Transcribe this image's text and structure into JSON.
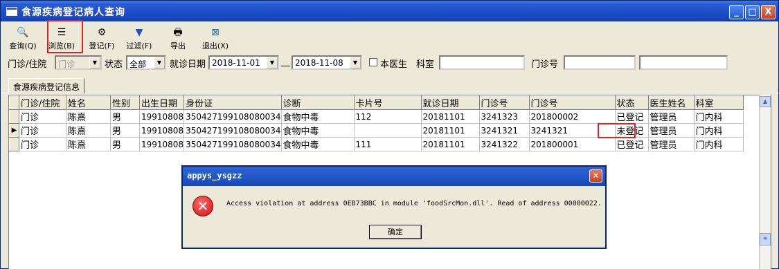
{
  "window": {
    "title": "食源疾病登记病人查询"
  },
  "titlebar_buttons": {
    "minimize": "_",
    "maximize": "□",
    "close": "X"
  },
  "toolbar": [
    {
      "label": "查询(Q)",
      "icon": "magnifier-icon",
      "glyph": "🔍"
    },
    {
      "label": "浏览(B)",
      "icon": "browse-list-icon",
      "glyph": "☰"
    },
    {
      "label": "登记(F)",
      "icon": "gear-icon",
      "glyph": "⚙"
    },
    {
      "label": "过滤(F)",
      "icon": "funnel-icon",
      "glyph": "▼"
    },
    {
      "label": "导出",
      "icon": "printer-icon",
      "glyph": "🖶"
    },
    {
      "label": "退出(X)",
      "icon": "exit-icon",
      "glyph": "⊠"
    }
  ],
  "filters": {
    "type_label": "门诊/住院",
    "type_value": "门诊",
    "status_label": "状态",
    "status_value": "全部",
    "date_label": "就诊日期",
    "date_from": "2018-11-01",
    "date_sep": "__",
    "date_to": "2018-11-08",
    "my_doctor_label": "本医生",
    "dept_label": "科室",
    "dept_value": "",
    "clinic_no_label": "门诊号",
    "clinic_no_value": "",
    "extra_value": ""
  },
  "tab": {
    "label": "食源疾病登记信息"
  },
  "table": {
    "columns": [
      "门诊/住院",
      "姓名",
      "性别",
      "出生日期",
      "身份证",
      "诊断",
      "卡片号",
      "就诊日期",
      "门诊号",
      "门诊号",
      "状态",
      "医生姓名",
      "科室"
    ],
    "rows": [
      [
        "门诊",
        "陈熹",
        "男",
        "19910808",
        "350427199108080034",
        "食物中毒",
        "112",
        "20181101",
        "3241323",
        "201800002",
        "已登记",
        "管理员",
        "门内科"
      ],
      [
        "门诊",
        "陈熹",
        "男",
        "19910808",
        "350427199108080034",
        "食物中毒",
        "",
        "20181101",
        "3241321",
        "3241321",
        "未登记",
        "管理员",
        "门内科"
      ],
      [
        "门诊",
        "陈熹",
        "男",
        "19910808",
        "350427199108080034",
        "食物中毒",
        "111",
        "20181101",
        "3241322",
        "201800001",
        "已登记",
        "管理员",
        "门内科"
      ]
    ],
    "current_row": 1
  },
  "dialog": {
    "title": "appys_ysgzz",
    "message": "Access violation at address 0EB73BBC in module 'foodSrcMon.dll'. Read of address 00000022.",
    "ok_label": "确定"
  },
  "colors": {
    "highlight": "#e02424",
    "title_blue": "#1f4fc9"
  }
}
